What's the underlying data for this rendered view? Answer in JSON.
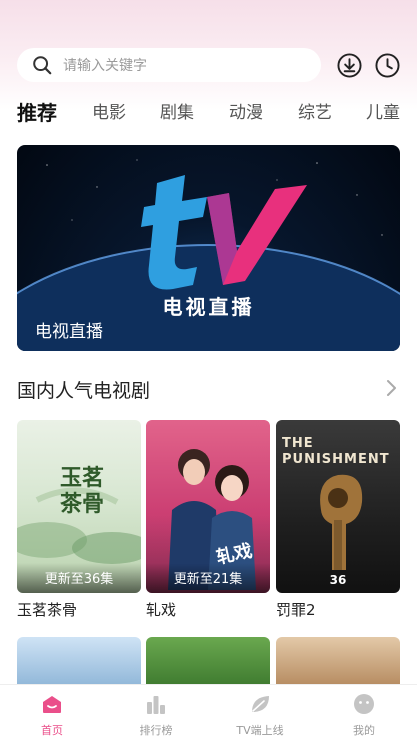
{
  "search": {
    "placeholder": "请输入关键字"
  },
  "top_icons": [
    "download-icon",
    "history-icon"
  ],
  "tabs": [
    {
      "label": "推荐",
      "active": true
    },
    {
      "label": "电影"
    },
    {
      "label": "剧集"
    },
    {
      "label": "动漫"
    },
    {
      "label": "综艺"
    },
    {
      "label": "儿童"
    }
  ],
  "banner": {
    "logo_text": "tv",
    "title": "电视直播",
    "label": "电视直播"
  },
  "section": {
    "title": "国内人气电视剧"
  },
  "cards": [
    {
      "title": "玉茗茶骨",
      "badge": "更新至36集",
      "poster_text": "玉茗茶骨"
    },
    {
      "title": "轧戏",
      "badge": "更新至21集",
      "poster_text": "轧戏"
    },
    {
      "title": "罚罪2",
      "badge": "",
      "poster_text": "THE PUNISHMENT",
      "rating": "36"
    }
  ],
  "bottom_nav": [
    {
      "label": "首页",
      "icon": "home-icon",
      "active": true
    },
    {
      "label": "排行榜",
      "icon": "ranking-icon"
    },
    {
      "label": "TV端上线",
      "icon": "leaf-icon"
    },
    {
      "label": "我的",
      "icon": "profile-icon"
    }
  ],
  "colors": {
    "accent": "#ea4f8a",
    "logo_blue": "#2f9fe0",
    "logo_pink": "#e8307d"
  }
}
